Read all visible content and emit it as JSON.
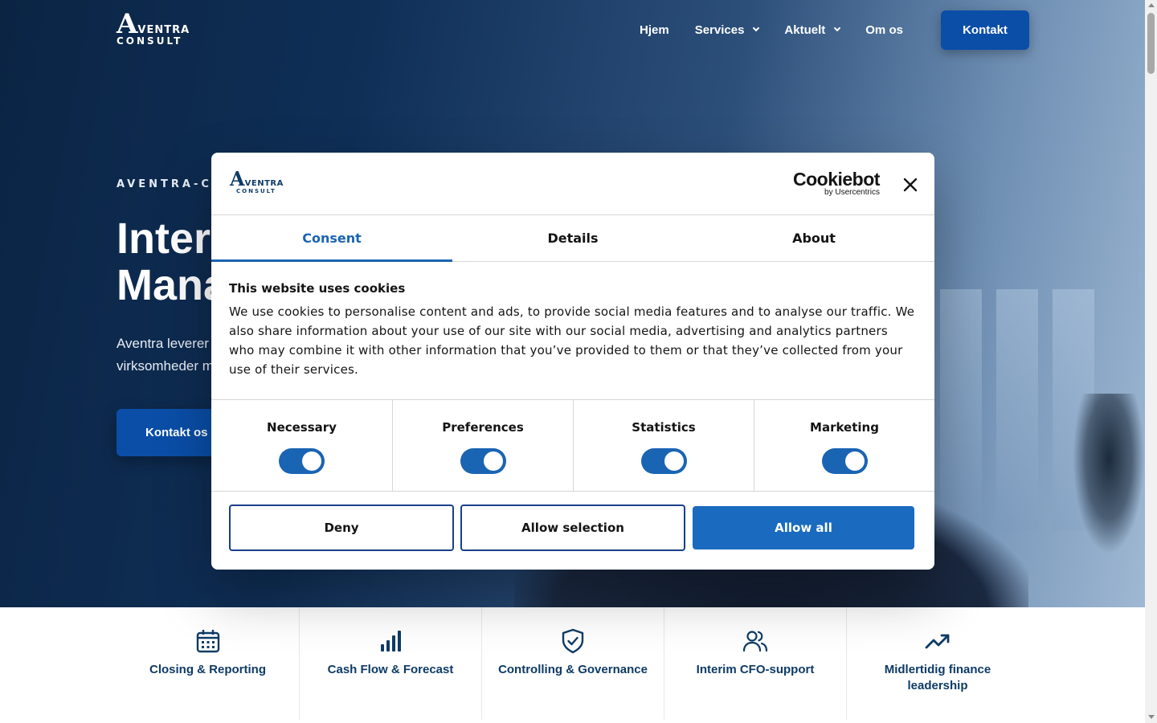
{
  "site": {
    "logo_big": "A",
    "logo_small1": "VENTRA",
    "logo_small2": "CONSULT",
    "nav": [
      {
        "label": "Hjem"
      },
      {
        "label": "Services"
      },
      {
        "label": "Aktuelt"
      },
      {
        "label": "Om os"
      }
    ],
    "contact_button": "Kontakt"
  },
  "hero": {
    "eyebrow": "AVENTRA-CO",
    "title_line1": "Inter",
    "title_line2": "Mana",
    "subtitle_line1": "Aventra leverer",
    "subtitle_line2": "virksomheder m",
    "cta": "Kontakt os"
  },
  "services": [
    {
      "label": "Closing & Reporting",
      "icon": "calendar-icon"
    },
    {
      "label": "Cash Flow & Forecast",
      "icon": "bar-chart-icon"
    },
    {
      "label": "Controlling & Governance",
      "icon": "shield-check-icon"
    },
    {
      "label": "Interim CFO-support",
      "icon": "users-icon"
    },
    {
      "label": "Midlertidig finance leadership",
      "icon": "trending-up-icon"
    }
  ],
  "cookie": {
    "brand": "Cookiebot",
    "brand_sub": "by Usercentrics",
    "tabs": [
      {
        "label": "Consent",
        "active": true
      },
      {
        "label": "Details",
        "active": false
      },
      {
        "label": "About",
        "active": false
      }
    ],
    "heading": "This website uses cookies",
    "body": "We use cookies to personalise content and ads, to provide social media features and to analyse our traffic. We also share information about your use of our site with our social media, advertising and analytics partners who may combine it with other information that you’ve provided to them or that they’ve collected from your use of their services.",
    "toggles": [
      {
        "label": "Necessary",
        "checked": true
      },
      {
        "label": "Preferences",
        "checked": true
      },
      {
        "label": "Statistics",
        "checked": true
      },
      {
        "label": "Marketing",
        "checked": true
      }
    ],
    "buttons": {
      "deny": "Deny",
      "allow_selection": "Allow selection",
      "allow_all": "Allow all"
    }
  },
  "colors": {
    "brand_blue": "#0a4ea8",
    "cookie_accent": "#1a64b4",
    "service_text": "#0e3b66"
  }
}
